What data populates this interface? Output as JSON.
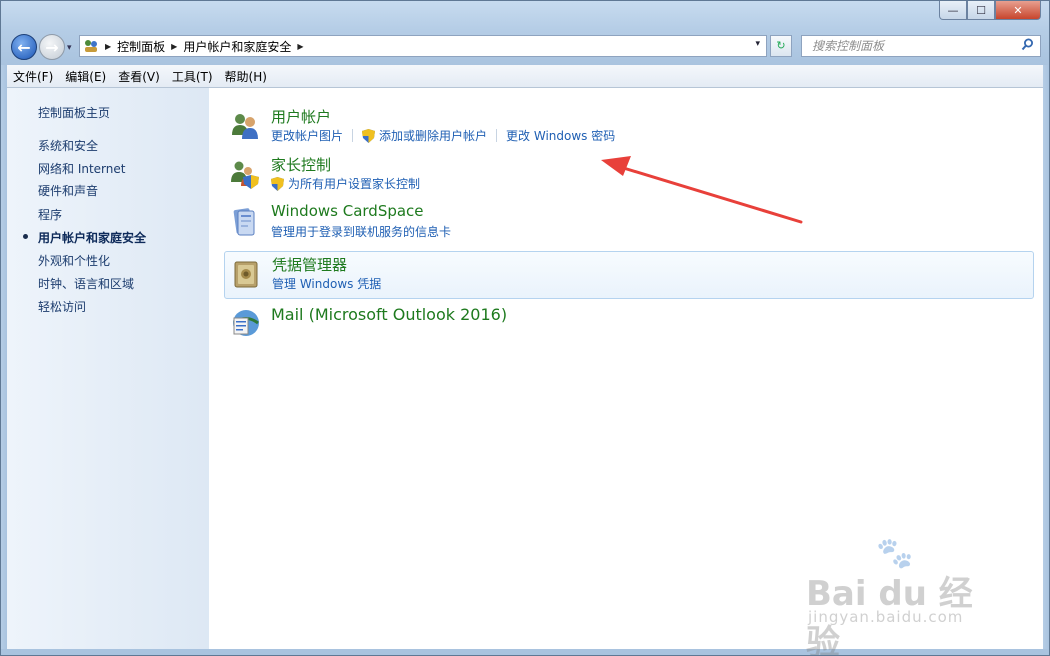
{
  "window": {
    "controls": {
      "minimize": "—",
      "maximize": "☐",
      "close": "✕"
    }
  },
  "nav": {
    "back_glyph": "←",
    "forward_glyph": "→",
    "recent_glyph": "▾"
  },
  "address": {
    "root_icon": "control-panel-icon",
    "breadcrumbs": [
      "控制面板",
      "用户帐户和家庭安全"
    ],
    "dropdown_glyph": "▾"
  },
  "refresh": {
    "glyph": "↻"
  },
  "search": {
    "placeholder": "搜索控制面板",
    "icon": "search-icon"
  },
  "menu": [
    "文件(F)",
    "编辑(E)",
    "查看(V)",
    "工具(T)",
    "帮助(H)"
  ],
  "sidebar": {
    "home": "控制面板主页",
    "items": [
      "系统和安全",
      "网络和 Internet",
      "硬件和声音",
      "程序",
      "用户帐户和家庭安全",
      "外观和个性化",
      "时钟、语言和区域",
      "轻松访问"
    ],
    "current_index": 4
  },
  "categories": [
    {
      "title": "用户帐户",
      "icon": "user-accounts-icon",
      "links": [
        "更改帐户图片",
        "添加或删除用户帐户",
        "更改 Windows 密码"
      ]
    },
    {
      "title": "家长控制",
      "icon": "parental-controls-icon",
      "links": [
        "为所有用户设置家长控制"
      ]
    },
    {
      "title": "Windows CardSpace",
      "icon": "cardspace-icon",
      "links": [
        "管理用于登录到联机服务的信息卡"
      ]
    },
    {
      "title": "凭据管理器",
      "icon": "credential-manager-icon",
      "links": [
        "管理 Windows 凭据"
      ]
    },
    {
      "title": "Mail (Microsoft Outlook 2016)",
      "icon": "mail-icon",
      "links": []
    }
  ],
  "colors": {
    "category_title": "#1e7a1e",
    "task_link": "#1f5fb3",
    "annotation_arrow": "#e8403a"
  },
  "watermark": {
    "main": "Bai du 经验",
    "sub": "jingyan.baidu.com"
  }
}
